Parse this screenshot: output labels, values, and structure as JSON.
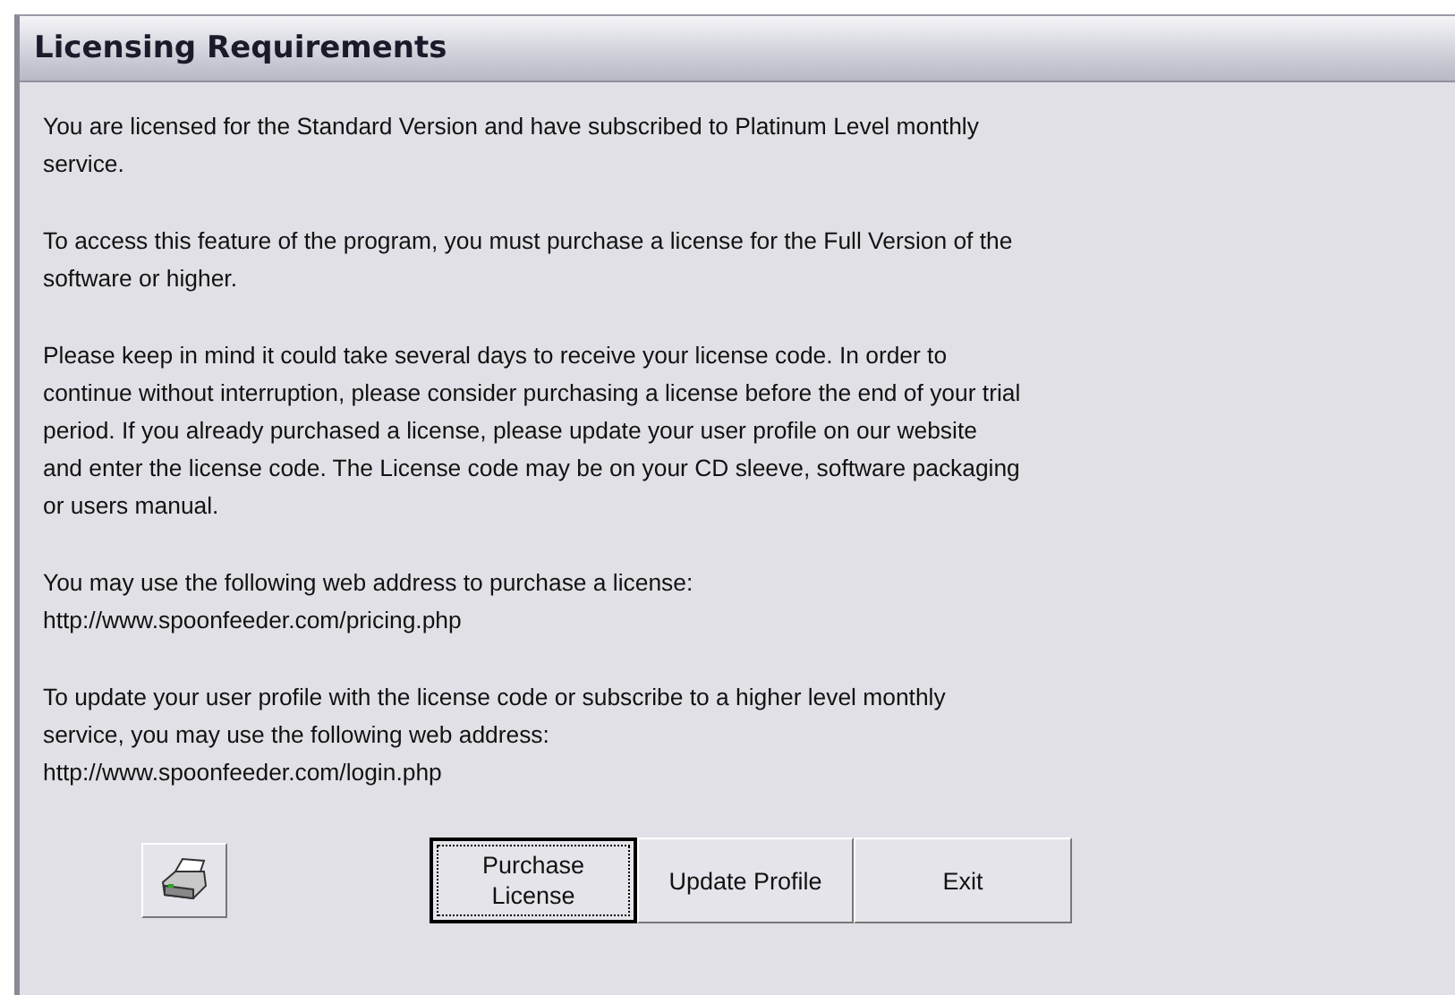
{
  "window": {
    "title": "Licensing Requirements"
  },
  "paragraphs": [
    [
      "You are licensed for the Standard Version and have subscribed to Platinum Level monthly",
      "service."
    ],
    [
      "To access this feature of the program, you must purchase a license for the Full Version of the",
      "software or higher."
    ],
    [
      "Please keep in mind it could take several days to receive your license code. In order to",
      "continue without interruption, please consider purchasing a license before the end of your trial",
      "period.  If you already purchased a license, please update your user profile on our website",
      "and enter the license code. The License code may be on your CD sleeve, software packaging",
      "or users manual."
    ],
    [
      "You may use the following web address to purchase a license:",
      "http://www.spoonfeeder.com/pricing.php"
    ],
    [
      "To update your user profile with the license code or subscribe to a higher level monthly",
      "service, you may use the following web address:",
      "http://www.spoonfeeder.com/login.php"
    ]
  ],
  "print_button": {
    "kind": "icon"
  },
  "buttons": [
    {
      "lines": [
        "Purchase",
        "License"
      ],
      "focused": true
    },
    {
      "lines": [
        "Update Profile"
      ],
      "focused": false
    },
    {
      "lines": [
        "Exit"
      ],
      "focused": false
    }
  ]
}
